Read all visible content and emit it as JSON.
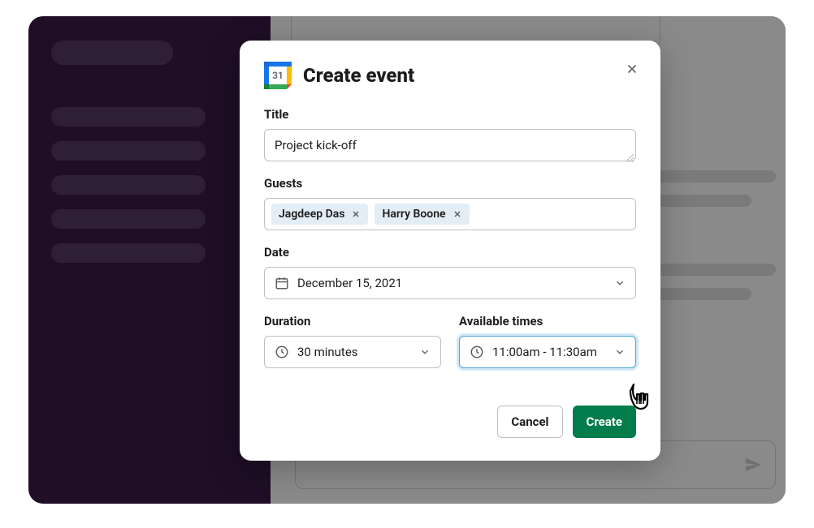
{
  "modal": {
    "title": "Create event",
    "fields": {
      "title": {
        "label": "Title",
        "value": "Project kick-off"
      },
      "guests": {
        "label": "Guests",
        "chips": [
          {
            "name": "Jagdeep Das"
          },
          {
            "name": "Harry Boone"
          }
        ]
      },
      "date": {
        "label": "Date",
        "value": "December 15, 2021"
      },
      "duration": {
        "label": "Duration",
        "value": "30 minutes"
      },
      "available_times": {
        "label": "Available times",
        "value": "11:00am - 11:30am"
      }
    },
    "buttons": {
      "cancel": "Cancel",
      "create": "Create"
    },
    "gcal_day": "31"
  }
}
